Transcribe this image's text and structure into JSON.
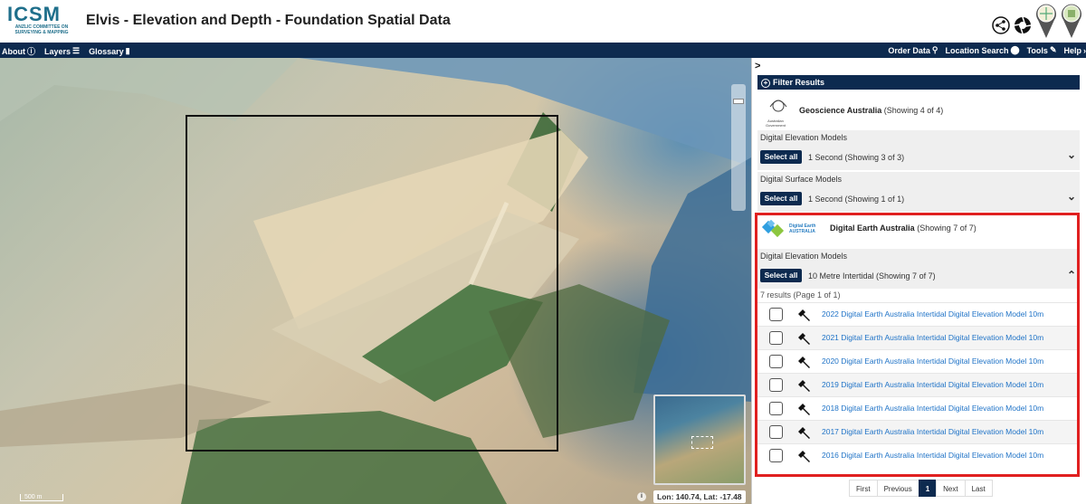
{
  "header": {
    "logo_text": "ICSM",
    "logo_sub": "ANZLIC COMMITTEE ON SURVEYING & MAPPING",
    "title": "Elvis - Elevation and Depth - Foundation Spatial Data",
    "icons": [
      "share-icon",
      "camera-icon",
      "pin-icon",
      "pin-icon"
    ]
  },
  "nav": {
    "left": [
      {
        "label": "About",
        "icon": "info-icon"
      },
      {
        "label": "Layers",
        "icon": "layers-icon"
      },
      {
        "label": "Glossary",
        "icon": "book-icon"
      }
    ],
    "right": [
      {
        "label": "Order Data",
        "icon": "search-icon"
      },
      {
        "label": "Location Search",
        "icon": "location-pin-icon"
      },
      {
        "label": "Tools",
        "icon": "pencil-icon"
      },
      {
        "label": "Help",
        "icon": "help-icon"
      }
    ]
  },
  "map": {
    "coords": "Lon: 140.74, Lat: -17.48",
    "scale": "500 m",
    "info": "i"
  },
  "panel": {
    "filter_label": "Filter Results",
    "providers": [
      {
        "name": "Geoscience Australia",
        "showing": "(Showing 4 of 4)",
        "logo_caption": "Australian Government",
        "groups": [
          {
            "title": "Digital Elevation Models",
            "select": "Select all",
            "sub": "1 Second (Showing 3 of 3)",
            "chevron": "⌄"
          },
          {
            "title": "Digital Surface Models",
            "select": "Select all",
            "sub": "1 Second (Showing 1 of 1)",
            "chevron": "⌄"
          }
        ]
      },
      {
        "name": "Digital Earth Australia",
        "showing": "(Showing 7 of 7)",
        "logo_caption": "Digital Earth AUSTRALIA",
        "groups": [
          {
            "title": "Digital Elevation Models",
            "select": "Select all",
            "sub": "10 Metre Intertidal (Showing 7 of 7)",
            "chevron": "⌃"
          }
        ]
      }
    ],
    "results_label": "7 results (Page 1 of 1)",
    "results": [
      "2022 Digital Earth Australia Intertidal Digital Elevation Model 10m",
      "2021 Digital Earth Australia Intertidal Digital Elevation Model 10m",
      "2020 Digital Earth Australia Intertidal Digital Elevation Model 10m",
      "2019 Digital Earth Australia Intertidal Digital Elevation Model 10m",
      "2018 Digital Earth Australia Intertidal Digital Elevation Model 10m",
      "2017 Digital Earth Australia Intertidal Digital Elevation Model 10m",
      "2016 Digital Earth Australia Intertidal Digital Elevation Model 10m"
    ],
    "pager": [
      "First",
      "Previous",
      "1",
      "Next",
      "Last"
    ],
    "pager_active": "1"
  },
  "colors": {
    "nav_bg": "#0d2a4f",
    "link": "#1f73c7",
    "highlight": "#e02020"
  }
}
